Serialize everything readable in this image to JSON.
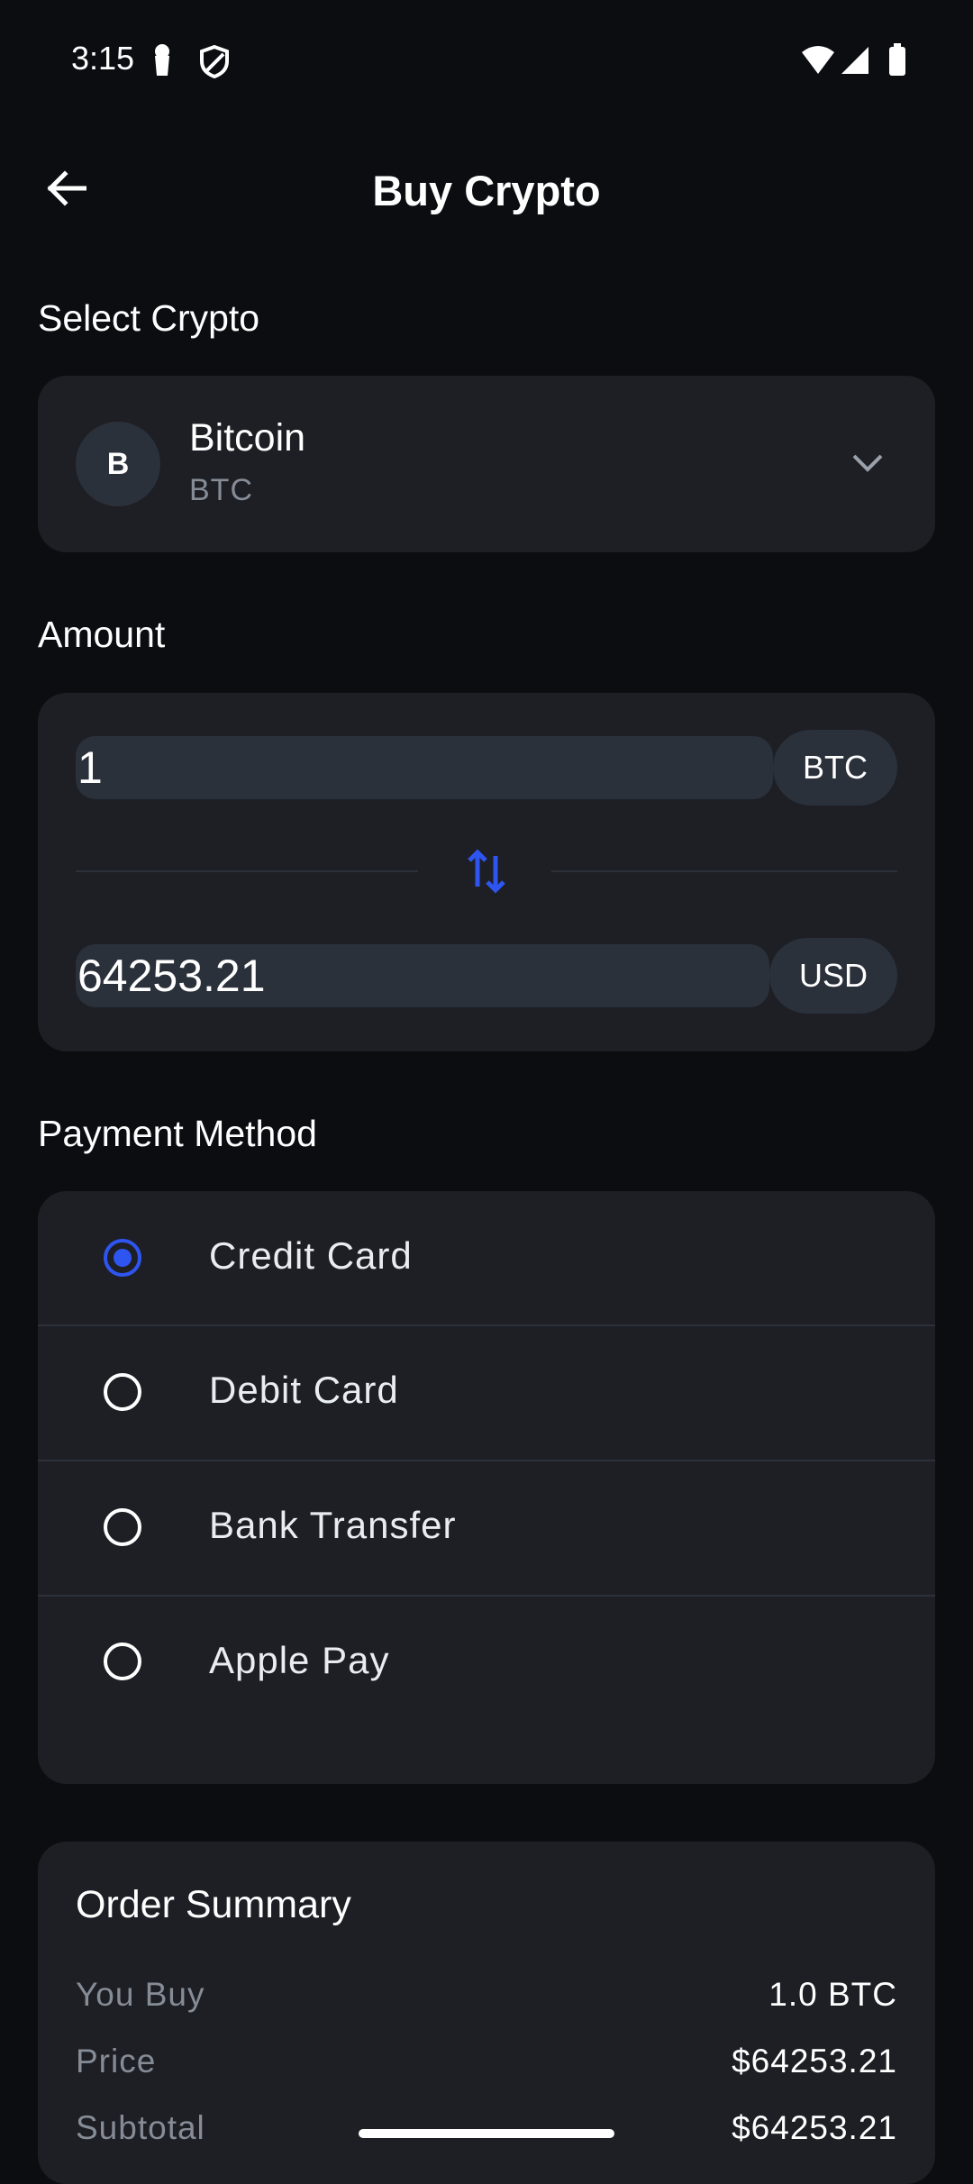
{
  "status_bar": {
    "time": "3:15"
  },
  "header": {
    "title": "Buy Crypto"
  },
  "select_crypto": {
    "label": "Select Crypto",
    "avatar_letter": "B",
    "name": "Bitcoin",
    "symbol": "BTC"
  },
  "amount": {
    "label": "Amount",
    "crypto_value": "1",
    "crypto_unit": "BTC",
    "fiat_value": "64253.21",
    "fiat_unit": "USD"
  },
  "payment": {
    "label": "Payment Method",
    "options": [
      {
        "label": "Credit Card",
        "selected": true
      },
      {
        "label": "Debit Card",
        "selected": false
      },
      {
        "label": "Bank Transfer",
        "selected": false
      },
      {
        "label": "Apple Pay",
        "selected": false
      }
    ]
  },
  "summary": {
    "title": "Order Summary",
    "rows": [
      {
        "label": "You Buy",
        "value": "1.0 BTC"
      },
      {
        "label": "Price",
        "value": "$64253.21"
      },
      {
        "label": "Subtotal",
        "value": "$64253.21"
      }
    ]
  },
  "colors": {
    "accent": "#2f55f0",
    "background": "#0b0d11",
    "card": "#1d1f25",
    "muted": "#868c96"
  },
  "icons": {
    "back": "arrow-left-icon",
    "dropdown": "chevron-down-icon",
    "swap": "swap-vertical-icon"
  }
}
